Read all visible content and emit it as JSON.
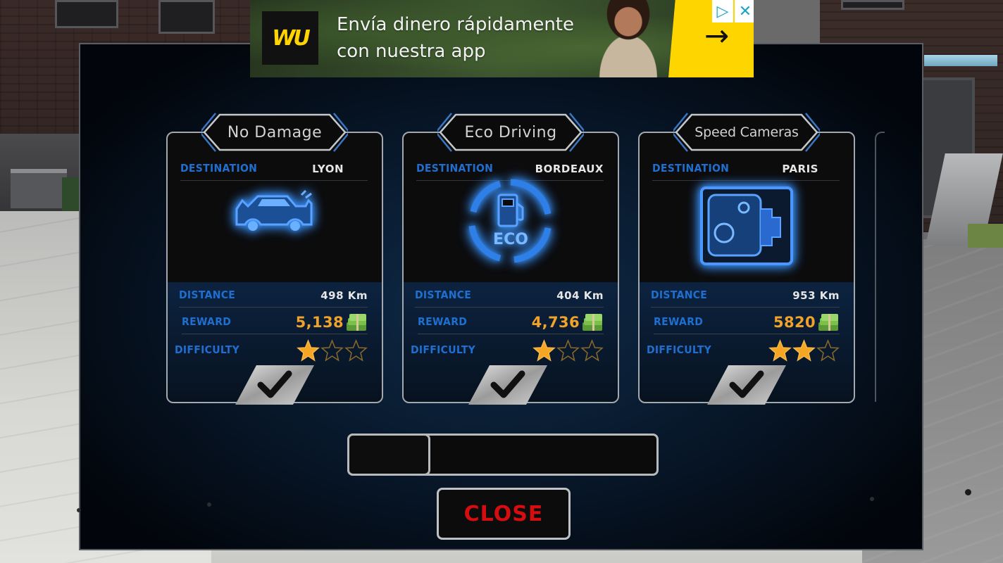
{
  "ad": {
    "brand_logo": "WU",
    "headline_line1": "Envía dinero rápidamente",
    "headline_line2": "con nuestra app",
    "cta_icon": "arrow-right-icon",
    "adchoices_icon": "adchoices-icon",
    "close_icon": "close-icon",
    "adchoices_glyph": "▷",
    "close_glyph": "✕",
    "arrow_glyph": "→"
  },
  "labels": {
    "destination": "DESTINATION",
    "distance": "DISTANCE",
    "reward": "REWARD",
    "difficulty": "DIFFICULTY"
  },
  "missions": [
    {
      "title": "No Damage",
      "destination": "LYON",
      "icon": "damaged-car-icon",
      "distance": "498 Km",
      "reward": "5,138",
      "difficulty": 1,
      "difficulty_max": 3
    },
    {
      "title": "Eco Driving",
      "destination": "BORDEAUX",
      "icon": "eco-fuel-pump-icon",
      "icon_text": "ECO",
      "distance": "404 Km",
      "reward": "4,736",
      "difficulty": 1,
      "difficulty_max": 3
    },
    {
      "title": "Speed Cameras",
      "destination": "PARIS",
      "icon": "speed-camera-icon",
      "distance": "953 Km",
      "reward": "5820",
      "difficulty": 2,
      "difficulty_max": 3
    }
  ],
  "scrollbar": {
    "position_fraction": 0.0,
    "visible_fraction": 0.27
  },
  "close_button": {
    "label": "CLOSE"
  },
  "colors": {
    "label_blue": "#1f6fd1",
    "reward_orange": "#f0a22a",
    "close_red": "#d40e10",
    "star_gold": "#f5a623",
    "icon_glow": "#2d7fe0",
    "ad_yellow": "#ffd500"
  }
}
